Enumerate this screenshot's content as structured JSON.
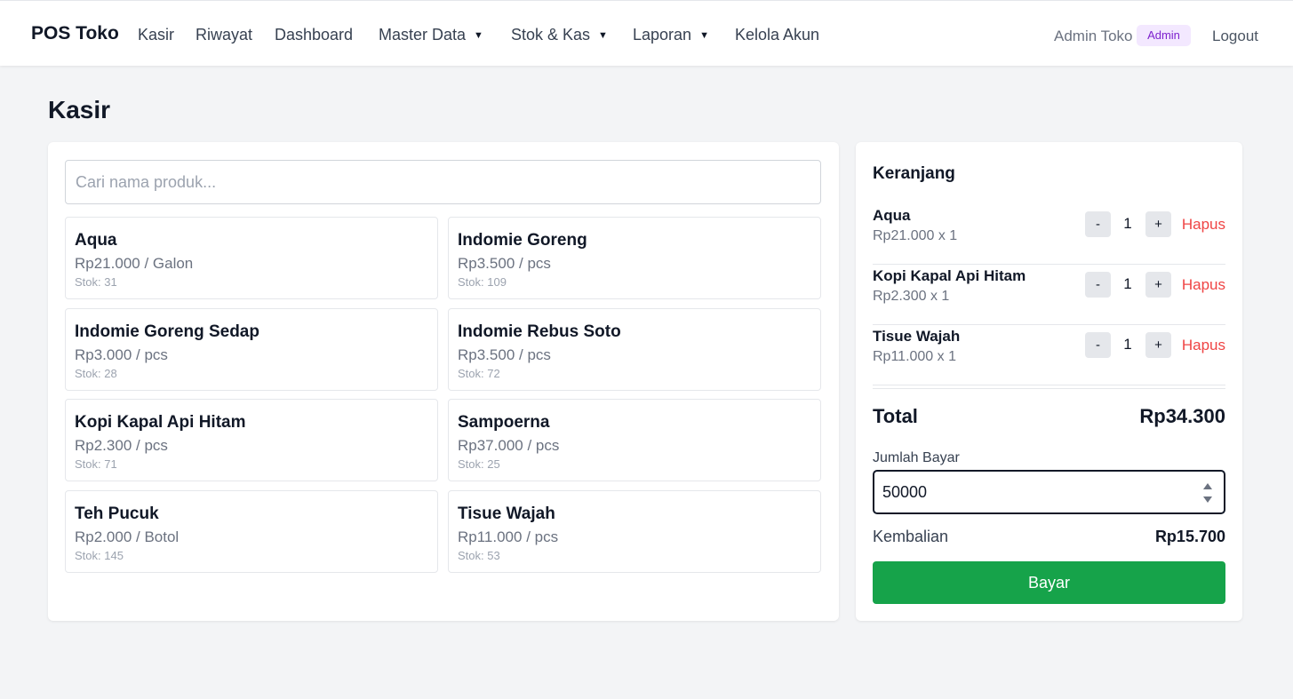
{
  "navbar": {
    "brand": "POS Toko",
    "items": [
      {
        "label": "Kasir"
      },
      {
        "label": "Riwayat"
      },
      {
        "label": "Dashboard"
      },
      {
        "label": "Master Data"
      },
      {
        "label": "Stok & Kas"
      },
      {
        "label": "Laporan"
      },
      {
        "label": "Kelola Akun"
      }
    ],
    "caret": "▼",
    "user_name": "Admin Toko",
    "role_badge": "Admin",
    "logout_label": "Logout"
  },
  "page": {
    "title": "Kasir"
  },
  "search": {
    "placeholder": "Cari nama produk...",
    "value": ""
  },
  "products": [
    {
      "name": "Aqua",
      "price": "Rp21.000 / Galon",
      "stock": "Stok: 31"
    },
    {
      "name": "Indomie Goreng",
      "price": "Rp3.500 / pcs",
      "stock": "Stok: 109"
    },
    {
      "name": "Indomie Goreng Sedap",
      "price": "Rp3.000 / pcs",
      "stock": "Stok: 28"
    },
    {
      "name": "Indomie Rebus Soto",
      "price": "Rp3.500 / pcs",
      "stock": "Stok: 72"
    },
    {
      "name": "Kopi Kapal Api Hitam",
      "price": "Rp2.300 / pcs",
      "stock": "Stok: 71"
    },
    {
      "name": "Sampoerna",
      "price": "Rp37.000 / pcs",
      "stock": "Stok: 25"
    },
    {
      "name": "Teh Pucuk",
      "price": "Rp2.000 / Botol",
      "stock": "Stok: 145"
    },
    {
      "name": "Tisue Wajah",
      "price": "Rp11.000 / pcs",
      "stock": "Stok: 53"
    }
  ],
  "cart": {
    "title": "Keranjang",
    "items": [
      {
        "name": "Aqua",
        "subtotal": "Rp21.000 x 1",
        "qty": "1",
        "minus": "-",
        "plus": "+",
        "remove": "Hapus"
      },
      {
        "name": "Kopi Kapal Api Hitam",
        "subtotal": "Rp2.300 x 1",
        "qty": "1",
        "minus": "-",
        "plus": "+",
        "remove": "Hapus"
      },
      {
        "name": "Tisue Wajah",
        "subtotal": "Rp11.000 x 1",
        "qty": "1",
        "minus": "-",
        "plus": "+",
        "remove": "Hapus"
      }
    ],
    "total_label": "Total",
    "total_value": "Rp34.300",
    "pay_label": "Jumlah Bayar",
    "pay_value": "50000",
    "change_label": "Kembalian",
    "change_value": "Rp15.700",
    "pay_button": "Bayar"
  },
  "colors": {
    "accent_green": "#16a34a",
    "danger_red": "#ef4444",
    "badge_bg": "#f3e8ff",
    "badge_text": "#7e22ce",
    "page_bg": "#f3f4f6"
  }
}
